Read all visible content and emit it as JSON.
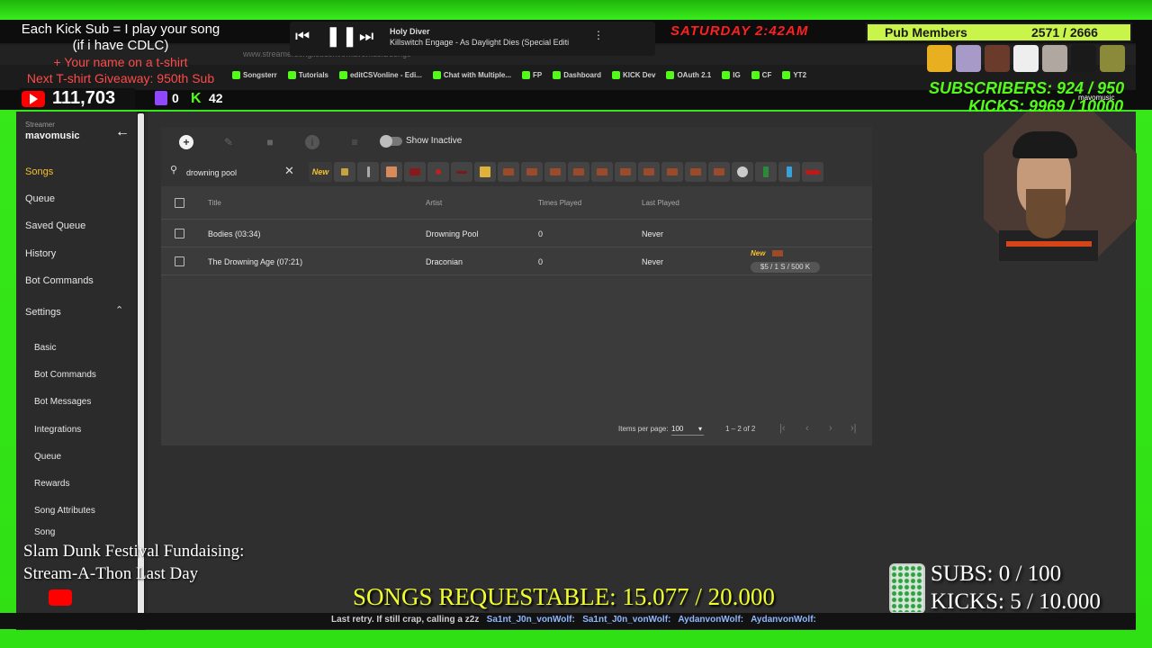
{
  "overlay": {
    "top_left": {
      "line1": "Each Kick Sub = I play your song",
      "line2": "(if i have CDLC)",
      "line3": "+ Your name on a t-shirt",
      "line4": "Next T-shirt Giveaway: 950th Sub"
    },
    "player": {
      "song_title": "Holy Diver",
      "song_artist": "Killswitch Engage - As Daylight Dies (Special Editi"
    },
    "clock": "SATURDAY 2:42AM",
    "pub_members": {
      "label": "Pub Members",
      "value": "2571 / 2666"
    },
    "youtube_subs": "111,703",
    "twitch_count": "0",
    "kick_count": "42",
    "subscribers_goal": "SUBSCRIBERS: 924 / 950",
    "kicks_goal": "KICKS: 9969 / 10000",
    "cam_label": "mavomusic",
    "fundraiser_line1": "Slam Dunk Festival Fundaising:",
    "fundraiser_line2": "Stream-A-Thon Last Day",
    "songs_requestable": "SONGS REQUESTABLE: 15.077 / 20.000",
    "subs_goal": "SUBS:  0 / 100",
    "kicks_bottom_goal": "KICKS: 5 / 10.000",
    "ticker": "Last retry. If still crap, calling a z2z",
    "ticker_names": [
      "Sa1nt_J0n_vonWolf:",
      "Sa1nt_J0n_vonWolf:",
      "AydanvonWolf:",
      "AydanvonWolf:"
    ]
  },
  "browser": {
    "url": "www.streamersonglist.com/t/mavomusic/songs",
    "bookmarks": [
      "Songsterr",
      "Tutorials",
      "editCSVonline - Edi...",
      "Chat with Multiple...",
      "FP",
      "Dashboard",
      "KICK Dev",
      "OAuth 2.1",
      "IG",
      "CF",
      "YT2"
    ]
  },
  "sidebar": {
    "streamer_label": "Streamer",
    "streamer_name": "mavomusic",
    "items": [
      "Songs",
      "Queue",
      "Saved Queue",
      "History",
      "Bot Commands",
      "Settings"
    ],
    "settings_items": [
      "Basic",
      "Bot Commands",
      "Bot Messages",
      "Integrations",
      "Queue",
      "Rewards",
      "Song Attributes",
      "Song"
    ]
  },
  "toolbar": {
    "show_inactive": "Show Inactive"
  },
  "search": {
    "value": "drowning pool"
  },
  "filters": {
    "new_label": "New"
  },
  "table": {
    "headers": [
      "Title",
      "Artist",
      "Times Played",
      "Last Played"
    ],
    "rows": [
      {
        "title": "Bodies (03:34)",
        "artist": "Drowning Pool",
        "times": "0",
        "last": "Never"
      },
      {
        "title": "The Drowning Age (07:21)",
        "artist": "Draconian",
        "times": "0",
        "last": "Never",
        "tag": "New",
        "price": "$5 / 1 S / 500 K"
      }
    ]
  },
  "pagination": {
    "items_label": "Items per page:",
    "per_page": "100",
    "range": "1 – 2 of 2"
  }
}
